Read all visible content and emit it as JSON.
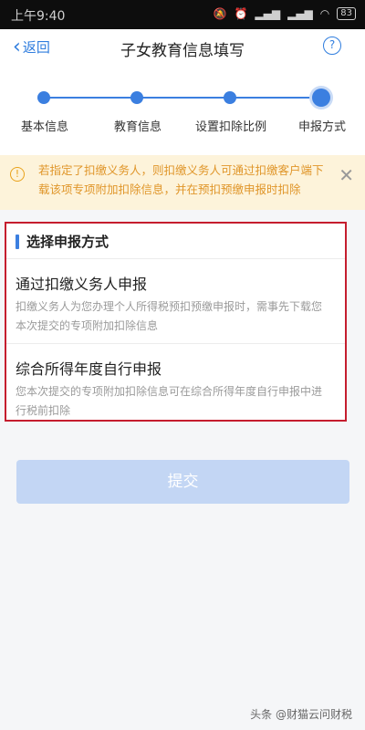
{
  "status_bar": {
    "time": "上午9:40",
    "battery": "83"
  },
  "nav": {
    "back_label": "返回",
    "title": "子女教育信息填写",
    "help_glyph": "?"
  },
  "steps": [
    {
      "label": "基本信息",
      "state": "done"
    },
    {
      "label": "教育信息",
      "state": "done"
    },
    {
      "label": "设置扣除比例",
      "state": "done"
    },
    {
      "label": "申报方式",
      "state": "current"
    }
  ],
  "notice": {
    "text": "若指定了扣缴义务人，则扣缴义务人可通过扣缴客户端下载该项专项附加扣除信息，并在预扣预缴申报时扣除"
  },
  "declaration": {
    "section_title": "选择申报方式",
    "options": [
      {
        "title": "通过扣缴义务人申报",
        "desc": "扣缴义务人为您办理个人所得税预扣预缴申报时，需事先下载您本次提交的专项附加扣除信息"
      },
      {
        "title": "综合所得年度自行申报",
        "desc": "您本次提交的专项附加扣除信息可在综合所得年度自行申报中进行税前扣除"
      }
    ]
  },
  "submit_label": "提交",
  "watermark": "头条 @财猫云问财税",
  "colors": {
    "accent": "#3b7fe0",
    "warning": "#e0962a",
    "highlight_border": "#c51d2e",
    "disabled_button": "#c3d6f4"
  }
}
